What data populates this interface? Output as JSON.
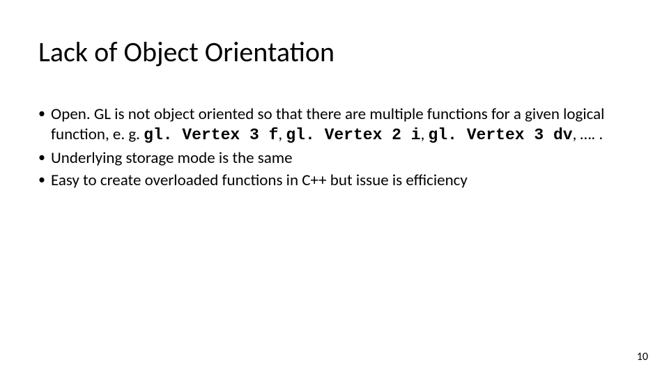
{
  "title": "Lack of Object Orientation",
  "bullets": [
    {
      "seg1": "Open. GL is not object oriented so that there are multiple functions for a given logical function, e. g. ",
      "code1": "gl. Vertex 3 f",
      "sep1": ", ",
      "code2": "gl. Vertex 2 i",
      "sep2": ", ",
      "code3": "gl. Vertex 3 dv",
      "tail": ", …. ."
    },
    {
      "text": "Underlying storage mode is the same"
    },
    {
      "text": "Easy to create overloaded functions in C++ but issue is efficiency"
    }
  ],
  "page_number": "10"
}
